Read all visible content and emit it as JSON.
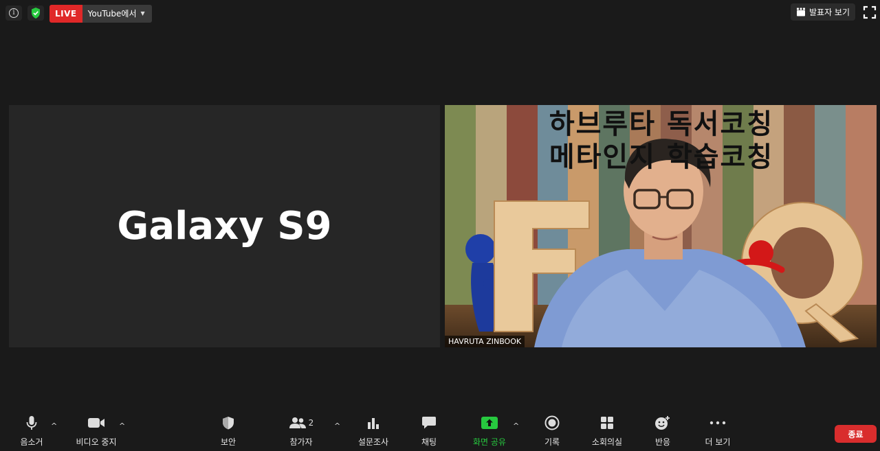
{
  "topbar": {
    "live_label": "LIVE",
    "stream_target": "YouTube에서",
    "view_button": "발표자 보기",
    "icons": {
      "info": "info-icon",
      "security": "shield-check-icon",
      "view": "clapper-icon",
      "fullscreen": "fullscreen-icon"
    },
    "colors": {
      "live": "#e02828",
      "security_green": "#27c93f"
    }
  },
  "video": {
    "left_tile_name": "Galaxy S9",
    "right_tile": {
      "title_lines": [
        "하브루타 독서코칭",
        "메타인지 학습코칭"
      ],
      "participant_name": "HAVRUTA ZINBOOK"
    }
  },
  "toolbar": {
    "mute": "음소거",
    "stop_video": "비디오 중지",
    "security": "보안",
    "participants": "참가자",
    "participants_count": "2",
    "polls": "설문조사",
    "chat": "채팅",
    "share_screen": "화면 공유",
    "record": "기록",
    "breakout": "소회의실",
    "reactions": "반응",
    "more": "더 보기",
    "end": "종료",
    "colors": {
      "share_green": "#27c93f",
      "end_red": "#d92d2d"
    }
  }
}
